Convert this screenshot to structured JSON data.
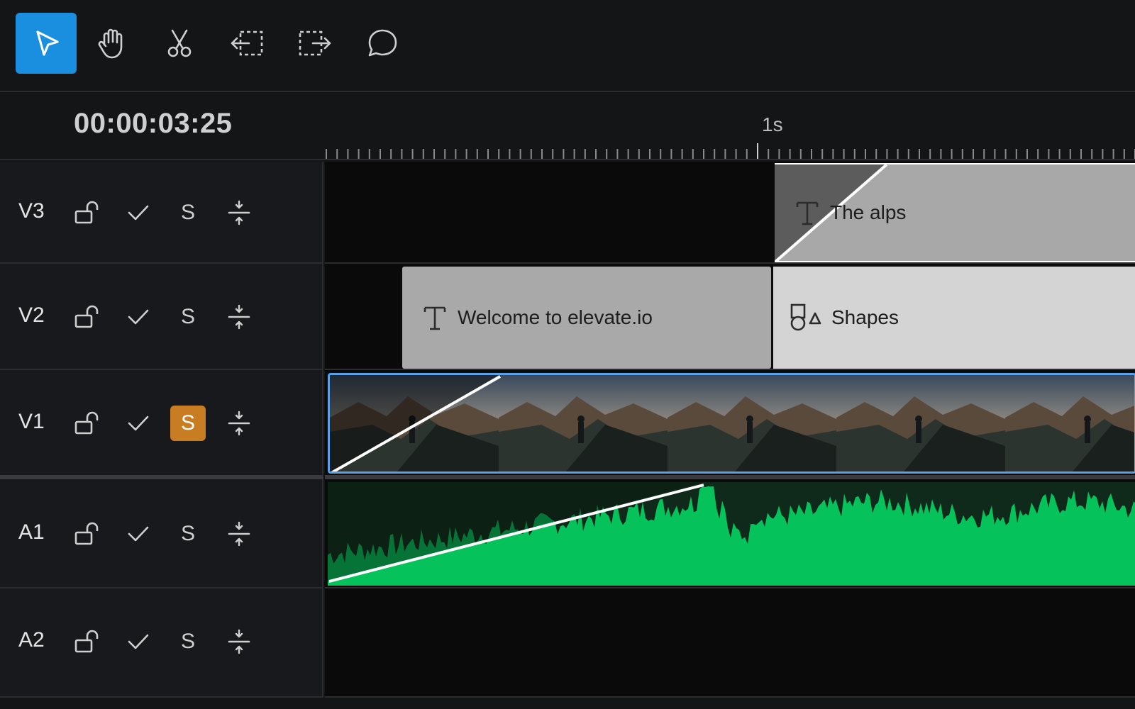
{
  "toolbar": {
    "tools": [
      {
        "id": "select",
        "icon": "pointer-icon",
        "active": true
      },
      {
        "id": "hand",
        "icon": "hand-icon",
        "active": false
      },
      {
        "id": "cut",
        "icon": "scissors-icon",
        "active": false
      },
      {
        "id": "trim-left",
        "icon": "trim-left-icon",
        "active": false
      },
      {
        "id": "trim-right",
        "icon": "trim-right-icon",
        "active": false
      },
      {
        "id": "comment",
        "icon": "comment-icon",
        "active": false
      }
    ],
    "accent": "#1a8fe0"
  },
  "timeline": {
    "timecode": "00:00:03:25",
    "ruler_label": "1s"
  },
  "tracks": [
    {
      "name": "V3",
      "solo": "S",
      "solo_active": false,
      "clips": [
        {
          "label": "The alps",
          "icon": "text-icon",
          "color": "#a8a8a8"
        }
      ]
    },
    {
      "name": "V2",
      "solo": "S",
      "solo_active": false,
      "clips": [
        {
          "label": "Welcome to elevate.io",
          "icon": "text-icon",
          "color": "#a9a9a9"
        },
        {
          "label": "Shapes",
          "icon": "shapes-icon",
          "color": "#d4d4d4"
        }
      ]
    },
    {
      "name": "V1",
      "solo": "S",
      "solo_active": true,
      "clips": [
        {
          "label": "",
          "icon": "video-thumbnail",
          "color": "#5aa0e6"
        }
      ]
    },
    {
      "name": "A1",
      "solo": "S",
      "solo_active": false,
      "clips": [
        {
          "label": "",
          "icon": "waveform",
          "color": "#05c35a"
        }
      ]
    },
    {
      "name": "A2",
      "solo": "S",
      "solo_active": false,
      "clips": []
    }
  ],
  "colors": {
    "solo_active": "#c97d22",
    "video_selection": "#5aa0e6",
    "audio_wave": "#05c35a"
  }
}
